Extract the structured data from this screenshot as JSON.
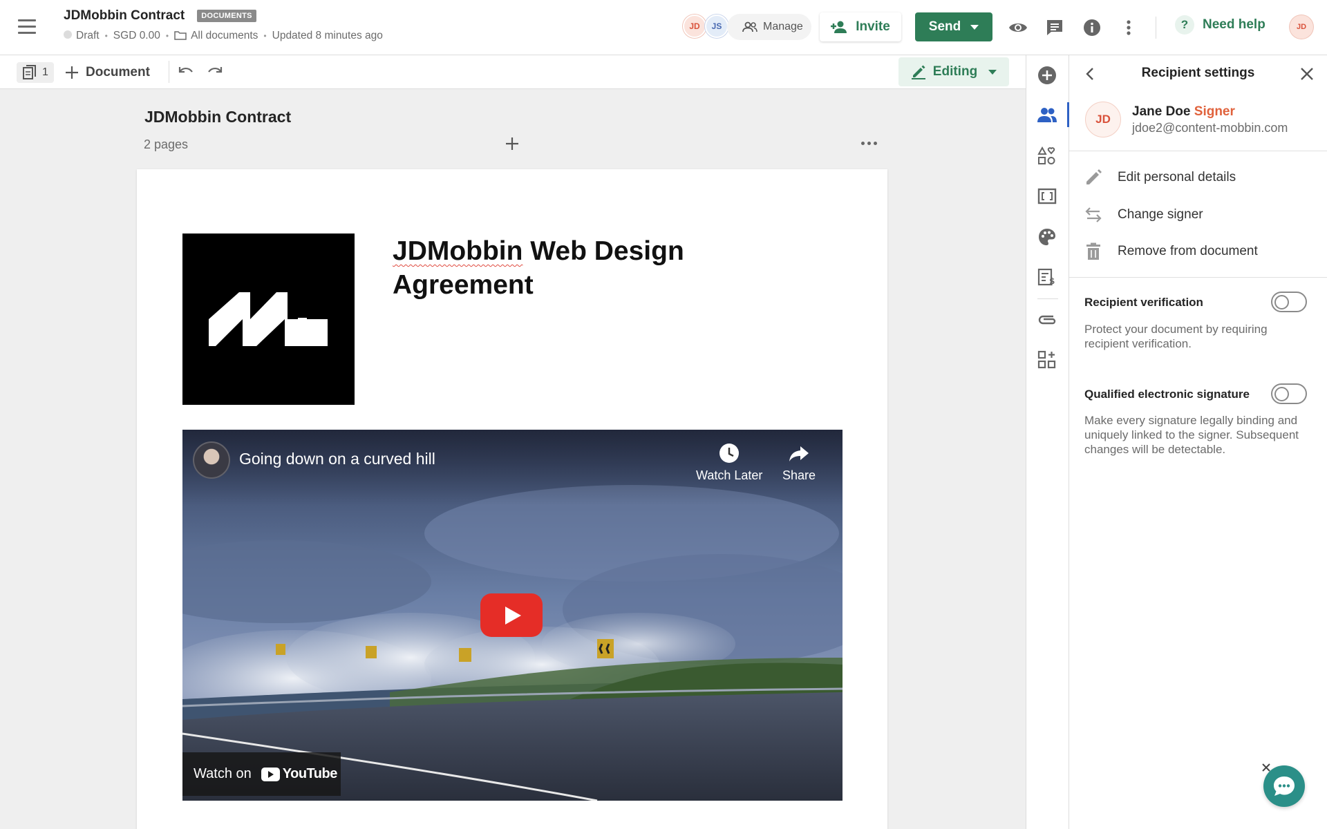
{
  "header": {
    "doc_title": "JDMobbin Contract",
    "badge": "DOCUMENTS",
    "status": "Draft",
    "amount": "SGD 0.00",
    "folder": "All documents",
    "updated": "Updated 8 minutes ago",
    "avatars": [
      "JD",
      "JS"
    ],
    "manage_label": "Manage",
    "invite_label": "Invite",
    "send_label": "Send",
    "help_label": "Need help",
    "user_avatar": "JD"
  },
  "toolbar": {
    "pages_count": "1",
    "document_label": "Document",
    "editing_label": "Editing"
  },
  "canvas": {
    "title": "JDMobbin Contract",
    "pages": "2 pages",
    "agreement_title_part1": "JDMobbin",
    "agreement_title_part2": " Web Design Agreement",
    "video": {
      "title": "Going down on a curved hill",
      "watch_later": "Watch Later",
      "share": "Share",
      "watch_on": "Watch on",
      "youtube": "YouTube"
    }
  },
  "panel": {
    "title": "Recipient settings",
    "recipient": {
      "initials": "JD",
      "name": "Jane Doe",
      "role": "Signer",
      "email": "jdoe2@content-mobbin.com"
    },
    "actions": [
      "Edit personal details",
      "Change signer",
      "Remove from document"
    ],
    "verification": {
      "label": "Recipient verification",
      "desc": "Protect your document by requiring recipient verification."
    },
    "qes": {
      "label": "Qualified electronic signature",
      "desc": "Make every signature legally binding and uniquely linked to the signer. Subsequent changes will be detectable."
    }
  },
  "colors": {
    "brand_green": "#2e7d57",
    "active_blue": "#2e61c4",
    "signer_orange": "#e0623c",
    "chat_teal": "#2b8f88"
  }
}
